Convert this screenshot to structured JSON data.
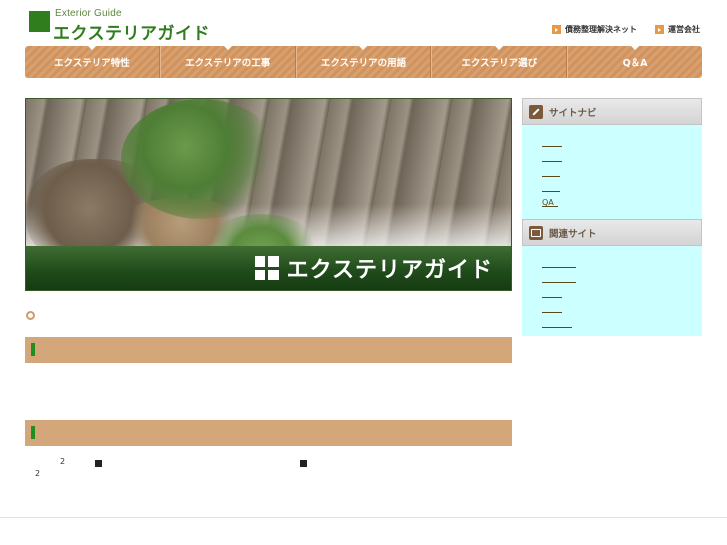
{
  "header": {
    "logo_en": "Exterior Guide",
    "logo_ja": "エクステリアガイド",
    "links": [
      {
        "label": "債務整理解決ネット"
      },
      {
        "label": "運営会社"
      }
    ]
  },
  "gnav": {
    "items": [
      {
        "label": "エクステリア特性"
      },
      {
        "label": "エクステリアの工事"
      },
      {
        "label": "エクステリアの用語"
      },
      {
        "label": "エクステリア選び"
      },
      {
        "label": "Q＆A"
      }
    ]
  },
  "hero": {
    "title": "エクステリアガイド"
  },
  "content": {
    "sup1": "2",
    "sup2": "2"
  },
  "sidebar": {
    "nav_title": "サイトナビ",
    "nav_links": [
      "",
      "",
      "",
      "",
      "QA"
    ],
    "related_title": "関連サイト",
    "related_links": [
      "",
      "",
      "",
      "",
      ""
    ]
  },
  "colors": {
    "brand_green": "#2f7d1d",
    "nav_tan": "#d9a06d",
    "section_bar": "#d3a77a",
    "sidebar_bg": "#ccffff"
  }
}
